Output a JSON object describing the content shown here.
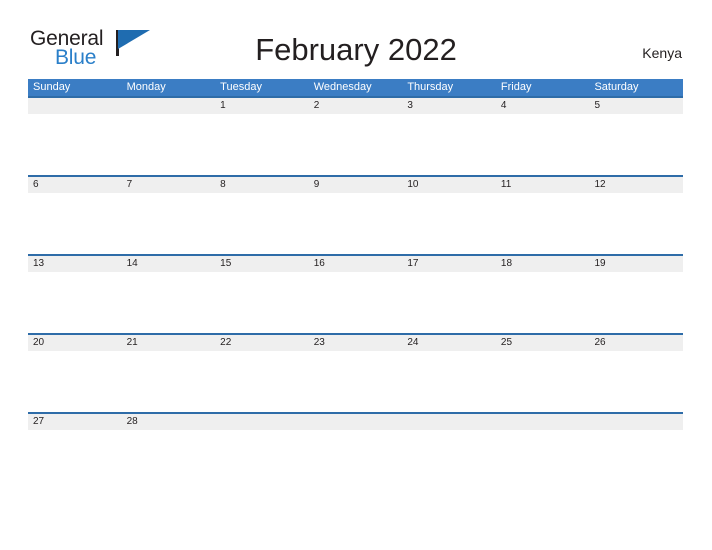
{
  "logo": {
    "word_one": "General",
    "word_two": "Blue",
    "flag_icon": "blue-flag-icon"
  },
  "header": {
    "title": "February 2022",
    "region": "Kenya"
  },
  "calendar": {
    "weekdays": [
      "Sunday",
      "Monday",
      "Tuesday",
      "Wednesday",
      "Thursday",
      "Friday",
      "Saturday"
    ],
    "weeks": [
      [
        "",
        "",
        "1",
        "2",
        "3",
        "4",
        "5"
      ],
      [
        "6",
        "7",
        "8",
        "9",
        "10",
        "11",
        "12"
      ],
      [
        "13",
        "14",
        "15",
        "16",
        "17",
        "18",
        "19"
      ],
      [
        "20",
        "21",
        "22",
        "23",
        "24",
        "25",
        "26"
      ],
      [
        "27",
        "28",
        "",
        "",
        "",
        "",
        ""
      ]
    ]
  },
  "colors": {
    "header_blue": "#3b7dc4",
    "row_divider_blue": "#2e6ca8",
    "date_strip_gray": "#efefef",
    "logo_blue": "#2a7fc9",
    "text_dark": "#231f20"
  }
}
